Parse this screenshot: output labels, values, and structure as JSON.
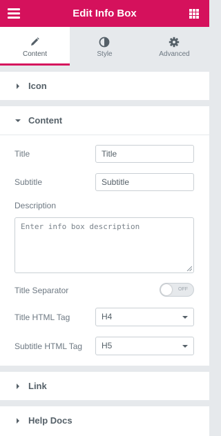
{
  "header": {
    "title": "Edit Info Box",
    "menu_icon": "hamburger-menu-icon",
    "grid_icon": "apps-grid-icon",
    "color": "#d5115c"
  },
  "tabs": [
    {
      "label": "Content",
      "icon": "pencil-icon",
      "active": true
    },
    {
      "label": "Style",
      "icon": "contrast-circle-icon",
      "active": false
    },
    {
      "label": "Advanced",
      "icon": "gear-icon",
      "active": false
    }
  ],
  "sections": {
    "icon": {
      "title": "Icon",
      "expanded": false
    },
    "content": {
      "title": "Content",
      "expanded": true
    },
    "link": {
      "title": "Link",
      "expanded": false
    },
    "help": {
      "title": "Help Docs",
      "expanded": false
    }
  },
  "fields": {
    "title": {
      "label": "Title",
      "value": "Title"
    },
    "subtitle": {
      "label": "Subtitle",
      "value": "Subtitle"
    },
    "description": {
      "label": "Description",
      "placeholder": "Enter info box description"
    },
    "separator": {
      "label": "Title Separator",
      "state": "OFF"
    },
    "title_tag": {
      "label": "Title HTML Tag",
      "value": "H4"
    },
    "subtitle_tag": {
      "label": "Subtitle HTML Tag",
      "value": "H5"
    }
  }
}
